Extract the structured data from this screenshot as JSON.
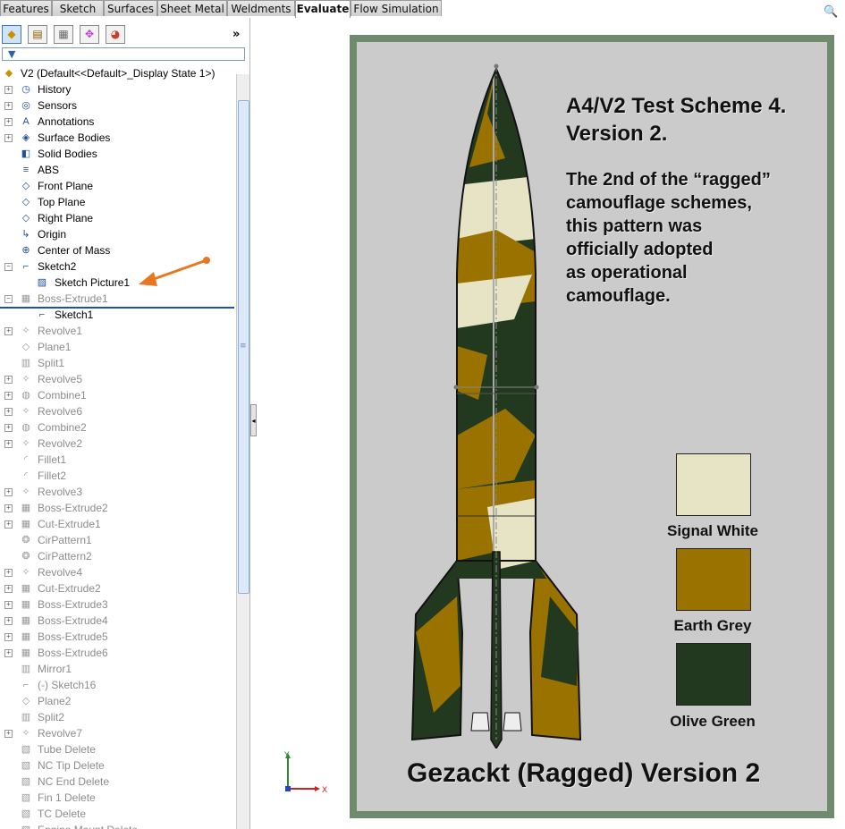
{
  "tabs": [
    {
      "label": "Features",
      "active": false
    },
    {
      "label": "Sketch",
      "active": false
    },
    {
      "label": "Surfaces",
      "active": false
    },
    {
      "label": "Sheet Metal",
      "active": false
    },
    {
      "label": "Weldments",
      "active": false
    },
    {
      "label": "Evaluate",
      "active": true
    },
    {
      "label": "Flow Simulation",
      "active": false
    }
  ],
  "panel": {
    "toolbar_icons": [
      "feature-manager-icon",
      "property-manager-icon",
      "configuration-manager-icon",
      "dimxpert-icon",
      "display-manager-icon"
    ],
    "expand_glyph": "»",
    "filter_icon": "filter-icon"
  },
  "tree": {
    "root": "V2  (Default<<Default>_Display State 1>)",
    "items": [
      {
        "label": "History",
        "icon": "history-icon",
        "glyph": "◷",
        "dim": false,
        "expander": true,
        "indent": 0
      },
      {
        "label": "Sensors",
        "icon": "sensor-icon",
        "glyph": "◎",
        "dim": false,
        "expander": true,
        "indent": 0
      },
      {
        "label": "Annotations",
        "icon": "annotations-icon",
        "glyph": "A",
        "dim": false,
        "expander": true,
        "indent": 0
      },
      {
        "label": "Surface Bodies",
        "icon": "surface-bodies-icon",
        "glyph": "◈",
        "dim": false,
        "expander": true,
        "indent": 0
      },
      {
        "label": "Solid Bodies",
        "icon": "solid-bodies-icon",
        "glyph": "◧",
        "dim": false,
        "expander": false,
        "indent": 0
      },
      {
        "label": "ABS",
        "icon": "material-icon",
        "glyph": "≡",
        "dim": false,
        "expander": false,
        "indent": 0
      },
      {
        "label": "Front Plane",
        "icon": "plane-icon",
        "glyph": "◇",
        "dim": false,
        "expander": false,
        "indent": 0
      },
      {
        "label": "Top Plane",
        "icon": "plane-icon",
        "glyph": "◇",
        "dim": false,
        "expander": false,
        "indent": 0
      },
      {
        "label": "Right Plane",
        "icon": "plane-icon",
        "glyph": "◇",
        "dim": false,
        "expander": false,
        "indent": 0
      },
      {
        "label": "Origin",
        "icon": "origin-icon",
        "glyph": "↳",
        "dim": false,
        "expander": false,
        "indent": 0
      },
      {
        "label": "Center of Mass",
        "icon": "center-of-mass-icon",
        "glyph": "⊕",
        "dim": false,
        "expander": false,
        "indent": 0
      },
      {
        "label": "Sketch2",
        "icon": "sketch-icon",
        "glyph": "⌐",
        "dim": false,
        "expander": true,
        "indent": 0
      },
      {
        "label": "Sketch Picture1",
        "icon": "picture-icon",
        "glyph": "▨",
        "dim": false,
        "expander": false,
        "indent": 1
      },
      {
        "label": "Boss-Extrude1",
        "icon": "extrude-icon",
        "glyph": "▦",
        "dim": true,
        "expander": true,
        "indent": 0
      },
      {
        "label": "Sketch1",
        "icon": "sketch-icon",
        "glyph": "⌐",
        "dim": false,
        "expander": false,
        "indent": 1
      },
      {
        "label": "Revolve1",
        "icon": "revolve-icon",
        "glyph": "✧",
        "dim": true,
        "expander": true,
        "indent": 0
      },
      {
        "label": "Plane1",
        "icon": "plane-icon",
        "glyph": "◇",
        "dim": true,
        "expander": false,
        "indent": 0
      },
      {
        "label": "Split1",
        "icon": "split-icon",
        "glyph": "▥",
        "dim": true,
        "expander": false,
        "indent": 0
      },
      {
        "label": "Revolve5",
        "icon": "revolve-icon",
        "glyph": "✧",
        "dim": true,
        "expander": true,
        "indent": 0
      },
      {
        "label": "Combine1",
        "icon": "combine-icon",
        "glyph": "◍",
        "dim": true,
        "expander": true,
        "indent": 0
      },
      {
        "label": "Revolve6",
        "icon": "revolve-icon",
        "glyph": "✧",
        "dim": true,
        "expander": true,
        "indent": 0
      },
      {
        "label": "Combine2",
        "icon": "combine-icon",
        "glyph": "◍",
        "dim": true,
        "expander": true,
        "indent": 0
      },
      {
        "label": "Revolve2",
        "icon": "revolve-icon",
        "glyph": "✧",
        "dim": true,
        "expander": true,
        "indent": 0
      },
      {
        "label": "Fillet1",
        "icon": "fillet-icon",
        "glyph": "◜",
        "dim": true,
        "expander": false,
        "indent": 0
      },
      {
        "label": "Fillet2",
        "icon": "fillet-icon",
        "glyph": "◜",
        "dim": true,
        "expander": false,
        "indent": 0
      },
      {
        "label": "Revolve3",
        "icon": "revolve-icon",
        "glyph": "✧",
        "dim": true,
        "expander": true,
        "indent": 0
      },
      {
        "label": "Boss-Extrude2",
        "icon": "extrude-icon",
        "glyph": "▦",
        "dim": true,
        "expander": true,
        "indent": 0
      },
      {
        "label": "Cut-Extrude1",
        "icon": "cut-extrude-icon",
        "glyph": "▦",
        "dim": true,
        "expander": true,
        "indent": 0
      },
      {
        "label": "CirPattern1",
        "icon": "circular-pattern-icon",
        "glyph": "❂",
        "dim": true,
        "expander": false,
        "indent": 0
      },
      {
        "label": "CirPattern2",
        "icon": "circular-pattern-icon",
        "glyph": "❂",
        "dim": true,
        "expander": false,
        "indent": 0
      },
      {
        "label": "Revolve4",
        "icon": "revolve-icon",
        "glyph": "✧",
        "dim": true,
        "expander": true,
        "indent": 0
      },
      {
        "label": "Cut-Extrude2",
        "icon": "cut-extrude-icon",
        "glyph": "▦",
        "dim": true,
        "expander": true,
        "indent": 0
      },
      {
        "label": "Boss-Extrude3",
        "icon": "extrude-icon",
        "glyph": "▦",
        "dim": true,
        "expander": true,
        "indent": 0
      },
      {
        "label": "Boss-Extrude4",
        "icon": "extrude-icon",
        "glyph": "▦",
        "dim": true,
        "expander": true,
        "indent": 0
      },
      {
        "label": "Boss-Extrude5",
        "icon": "extrude-icon",
        "glyph": "▦",
        "dim": true,
        "expander": true,
        "indent": 0
      },
      {
        "label": "Boss-Extrude6",
        "icon": "extrude-icon",
        "glyph": "▦",
        "dim": true,
        "expander": true,
        "indent": 0
      },
      {
        "label": "Mirror1",
        "icon": "mirror-icon",
        "glyph": "▥",
        "dim": true,
        "expander": false,
        "indent": 0
      },
      {
        "label": "(-) Sketch16",
        "icon": "sketch-icon",
        "glyph": "⌐",
        "dim": true,
        "expander": false,
        "indent": 0
      },
      {
        "label": "Plane2",
        "icon": "plane-icon",
        "glyph": "◇",
        "dim": true,
        "expander": false,
        "indent": 0
      },
      {
        "label": "Split2",
        "icon": "split-icon",
        "glyph": "▥",
        "dim": true,
        "expander": false,
        "indent": 0
      },
      {
        "label": "Revolve7",
        "icon": "revolve-icon",
        "glyph": "✧",
        "dim": true,
        "expander": true,
        "indent": 0
      },
      {
        "label": "Tube Delete",
        "icon": "delete-face-icon",
        "glyph": "▧",
        "dim": true,
        "expander": false,
        "indent": 0
      },
      {
        "label": "NC Tip Delete",
        "icon": "delete-face-icon",
        "glyph": "▧",
        "dim": true,
        "expander": false,
        "indent": 0
      },
      {
        "label": "NC End Delete",
        "icon": "delete-face-icon",
        "glyph": "▧",
        "dim": true,
        "expander": false,
        "indent": 0
      },
      {
        "label": "Fin 1 Delete",
        "icon": "delete-face-icon",
        "glyph": "▧",
        "dim": true,
        "expander": false,
        "indent": 0
      },
      {
        "label": "TC Delete",
        "icon": "delete-face-icon",
        "glyph": "▧",
        "dim": true,
        "expander": false,
        "indent": 0
      },
      {
        "label": "Engine Mount Delete",
        "icon": "delete-face-icon",
        "glyph": "▧",
        "dim": true,
        "expander": false,
        "indent": 0
      }
    ]
  },
  "poster": {
    "title_line1": "A4/V2 Test Scheme 4.",
    "title_line2": "Version 2.",
    "desc_lines": [
      "The 2nd of the “ragged”",
      "camouflage schemes,",
      "this pattern was",
      "officially adopted",
      "as operational",
      "camouflage."
    ],
    "swatches": [
      {
        "name": "Signal White",
        "color": "#e6e4c4"
      },
      {
        "name": "Earth Grey",
        "color": "#9a7200"
      },
      {
        "name": "Olive Green",
        "color": "#23391f"
      }
    ],
    "footer": "Gezackt (Ragged) Version 2",
    "border_color": "#6f8a6c",
    "background_color": "#cbcbcb"
  },
  "triad": {
    "x_label": "X",
    "y_label": "Y"
  },
  "colors": {
    "annotation_arrow": "#e87722",
    "rollback_bar": "#1e4fb8"
  }
}
